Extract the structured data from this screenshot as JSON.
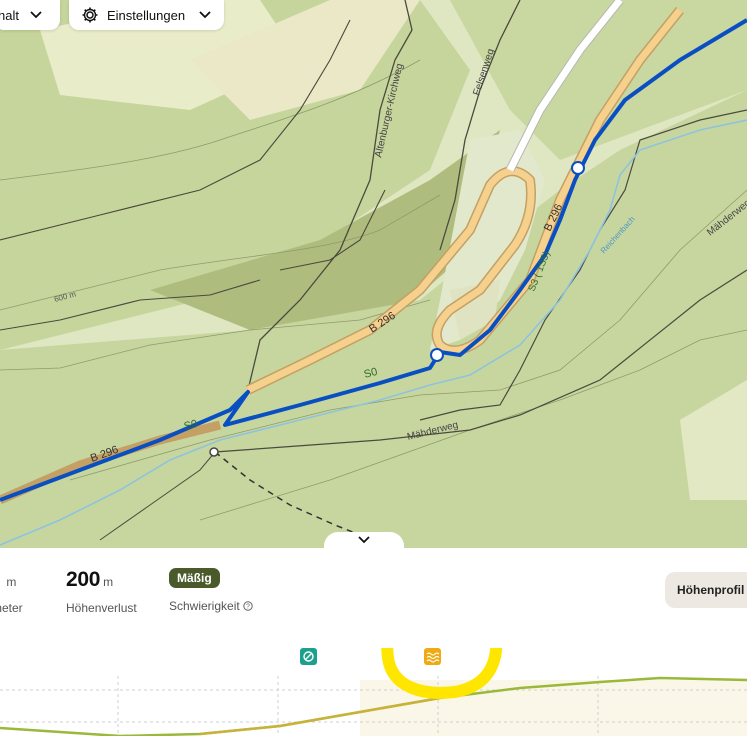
{
  "map": {
    "road_labels": {
      "b296_lower": "B 296",
      "b296_middle": "B 296",
      "b296_right": "B 296",
      "s0_a": "S0",
      "s0_b": "S0",
      "s3": "S3 ( 1S5)"
    },
    "path_labels": {
      "altenburger": "Altenburger-Kirchweg",
      "felsenweg": "Felsenweg",
      "maehderweg_bottom": "Mähderweg",
      "maehderweg_right": "Mähderweg",
      "reichenbach": "Reichenbach"
    },
    "contour_label": "600 m",
    "colors": {
      "route": "#0a4fc2",
      "forest": "#c3d39a",
      "road": "#f3d28b",
      "annotation": "#ffe600"
    }
  },
  "toolbar": {
    "left_pill_label": "halt",
    "settings_label": "Einstellungen"
  },
  "stats": {
    "partial_unit": "m",
    "partial_label": "meter",
    "descent_value": "200",
    "descent_unit": "m",
    "descent_label": "Höhenverlust",
    "difficulty_badge": "Mäßig",
    "difficulty_label": "Schwierigkeit",
    "elevation_profile_button": "Höhenprofil"
  },
  "icons": {
    "collapse": "chevron-down-icon",
    "settings": "gear-icon",
    "info": "info-icon",
    "marker_teal": "no-entry-icon",
    "marker_orange": "waves-icon"
  }
}
